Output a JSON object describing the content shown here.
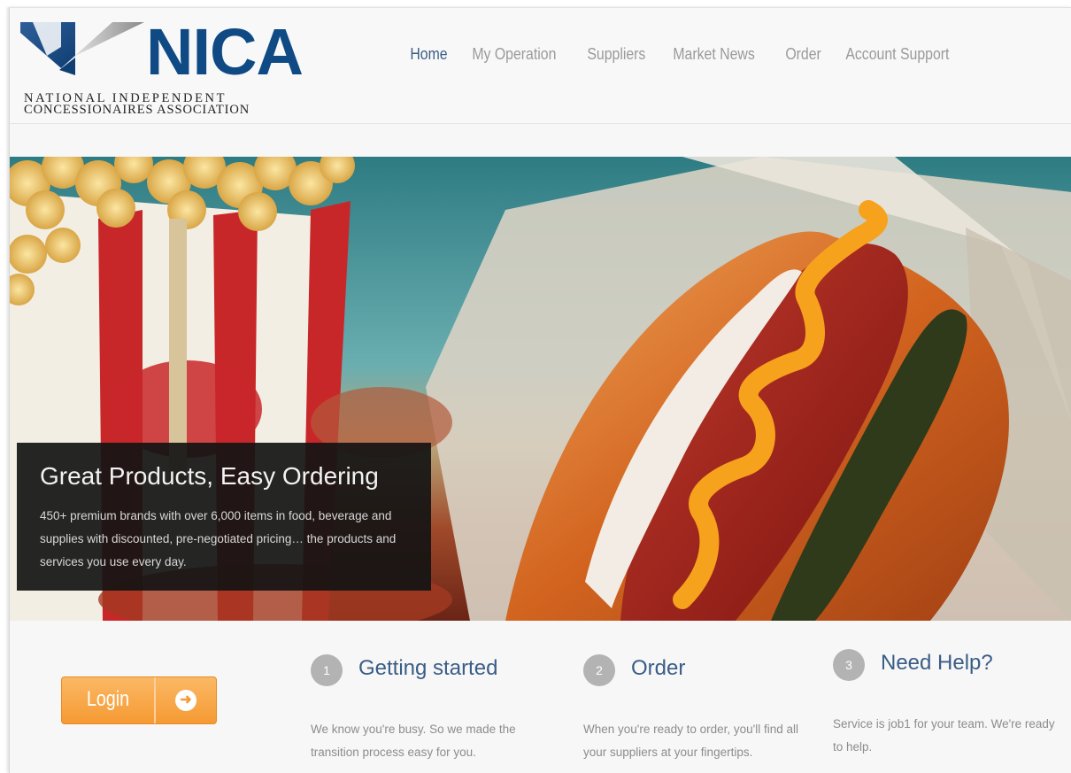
{
  "logo": {
    "name": "NICA",
    "tagline_line1": "NATIONAL INDEPENDENT",
    "tagline_line2": "CONCESSIONAIRES ASSOCIATION"
  },
  "nav": {
    "items": [
      {
        "label": "Home",
        "active": true
      },
      {
        "label": "My Operation",
        "active": false
      },
      {
        "label": "Suppliers",
        "active": false
      },
      {
        "label": "Market News",
        "active": false
      },
      {
        "label": "Order",
        "active": false
      },
      {
        "label": "Account Support",
        "active": false
      }
    ]
  },
  "hero": {
    "headline": "Great Products, Easy Ordering",
    "body": "450+ premium brands with over 6,000 items in food, beverage and supplies with discounted, pre-negotiated pricing… the products and services you use every day."
  },
  "login": {
    "label": "Login",
    "icon": "arrow-right-circle-icon"
  },
  "steps": [
    {
      "number": "1",
      "title": "Getting started",
      "description": "We know you're busy. So we made the transition process easy for you."
    },
    {
      "number": "2",
      "title": "Order",
      "description": "When you're ready to order, you'll find all your suppliers at your fingertips."
    },
    {
      "number": "3",
      "title": "Need Help?",
      "description": "Service is job1 for your team. We're ready to help."
    }
  ],
  "colors": {
    "brand_blue": "#0f4a84",
    "nav_active": "#3a5d86",
    "nav_inactive": "#9a9a9a",
    "login_orange": "#f59a33",
    "caption_bg": "#141414"
  }
}
